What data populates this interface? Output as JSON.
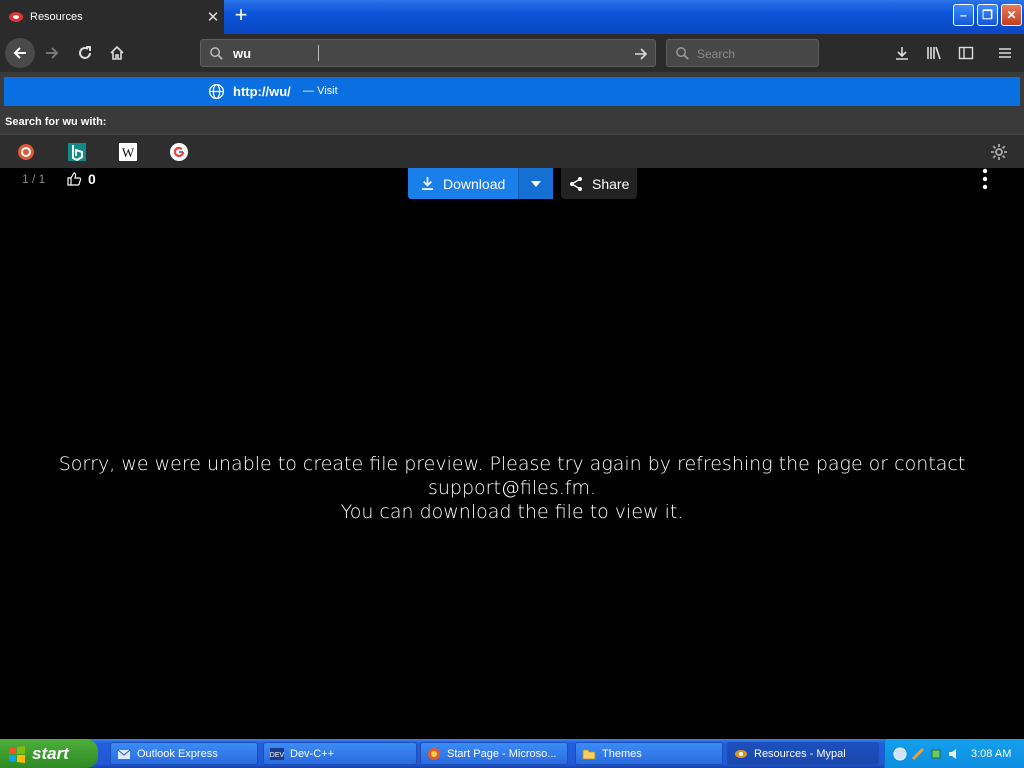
{
  "browser": {
    "tab": {
      "title": "Resources"
    },
    "urlbar": {
      "value": "wu"
    },
    "searchbar": {
      "placeholder": "Search"
    }
  },
  "dropdown": {
    "suggestion": {
      "url": "http://wu/",
      "separator": "—",
      "action": "Visit"
    },
    "search_with_label": "Search for wu with:",
    "engines": [
      "duckduckgo-icon",
      "bing-icon",
      "wikipedia-icon",
      "google-icon"
    ]
  },
  "page": {
    "pager": "1 / 1",
    "likes": "0",
    "download_label": "Download",
    "share_label": "Share",
    "message_line1": "Sorry, we were unable to create file preview. Please try again by refreshing the page or contact support@files.fm.",
    "message_line2": "You can download the file to view it."
  },
  "taskbar": {
    "start_label": "start",
    "tasks": [
      {
        "label": "Outlook Express"
      },
      {
        "label": "Dev-C++"
      },
      {
        "label": "Start Page - Microso..."
      },
      {
        "label": "Themes"
      },
      {
        "label": "Resources - Mypal"
      }
    ],
    "clock": "3:08 AM"
  },
  "colors": {
    "accent": "#0a6fe0",
    "download": "#1a7fe8",
    "taskbar": "#245edc",
    "start": "#3c9a2e"
  }
}
